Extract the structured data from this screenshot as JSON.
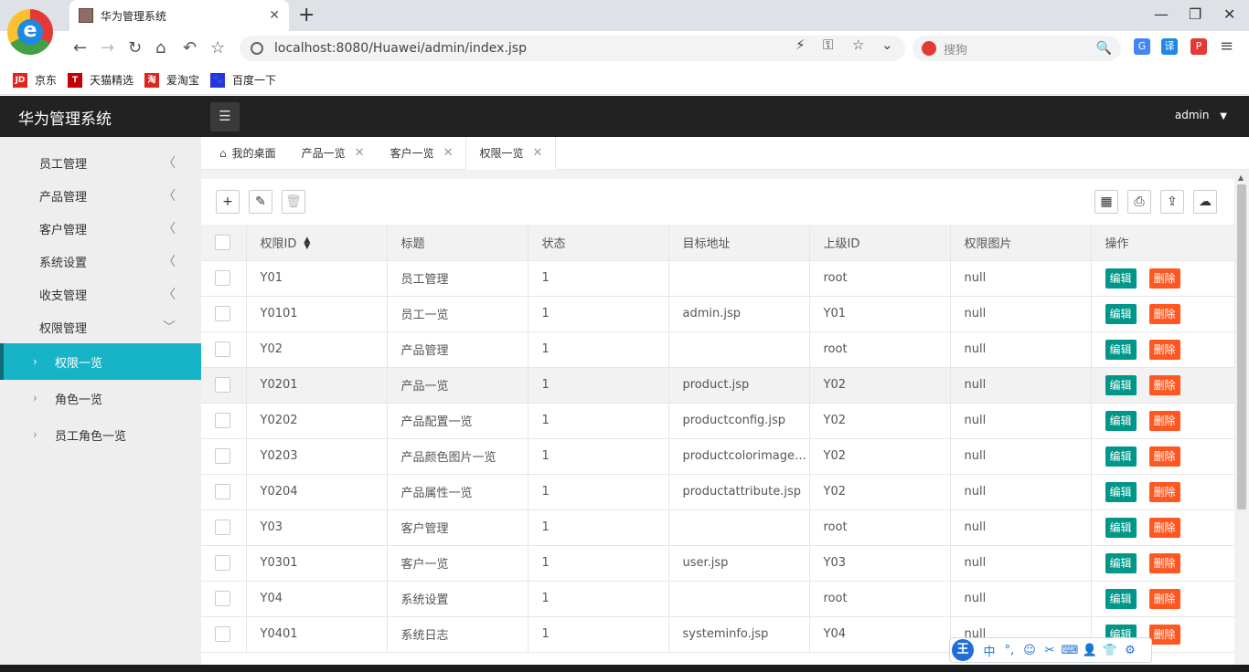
{
  "browser": {
    "tab_title": "华为管理系统",
    "tab_close": "✕",
    "new_tab": "+",
    "url": "localhost:8080/Huawei/admin/index.jsp",
    "search_placeholder": "搜狗",
    "logo_letter": "e",
    "win_min": "—",
    "win_max": "❐",
    "win_close": "✕",
    "ext_translate": "译",
    "ext_g": "G",
    "ext_pdf": "P"
  },
  "bookmarks": [
    {
      "label": "京东",
      "icon": "JD",
      "color": "#e1251b"
    },
    {
      "label": "天猫精选",
      "icon": "T",
      "color": "#c40000"
    },
    {
      "label": "爱淘宝",
      "icon": "淘",
      "color": "#e1251b"
    },
    {
      "label": "百度一下",
      "icon": "🐾",
      "color": "#2932e1"
    }
  ],
  "header": {
    "title": "华为管理系统",
    "menu_toggle": "☰",
    "user": "admin",
    "user_caret": "▼"
  },
  "sidebar": {
    "groups": [
      {
        "label": "员工管理",
        "chev": "〈"
      },
      {
        "label": "产品管理",
        "chev": "〈"
      },
      {
        "label": "客户管理",
        "chev": "〈"
      },
      {
        "label": "系统设置",
        "chev": "〈"
      },
      {
        "label": "收支管理",
        "chev": "〈"
      },
      {
        "label": "权限管理",
        "chev": "﹀"
      }
    ],
    "subitems": [
      {
        "label": "权限一览",
        "arrow": "›"
      },
      {
        "label": "角色一览",
        "arrow": "›"
      },
      {
        "label": "员工角色一览",
        "arrow": "›"
      }
    ]
  },
  "tabs": {
    "home": "我的桌面",
    "items": [
      "产品一览",
      "客户一览",
      "权限一览"
    ],
    "close": "✕"
  },
  "toolbar": {
    "add": "+",
    "edit": "✎",
    "delete": "🗑",
    "columns": "▦",
    "print": "⎙",
    "export": "⇪",
    "upload": "☁"
  },
  "table": {
    "columns": [
      "权限ID",
      "标题",
      "状态",
      "目标地址",
      "上级ID",
      "权限图片",
      "操作"
    ],
    "sort_icon": "▲▼",
    "edit_label": "编辑",
    "delete_label": "删除",
    "rows": [
      [
        "Y01",
        "员工管理",
        "1",
        "",
        "root",
        "null"
      ],
      [
        "Y0101",
        "员工一览",
        "1",
        "admin.jsp",
        "Y01",
        "null"
      ],
      [
        "Y02",
        "产品管理",
        "1",
        "",
        "root",
        "null"
      ],
      [
        "Y0201",
        "产品一览",
        "1",
        "product.jsp",
        "Y02",
        "null"
      ],
      [
        "Y0202",
        "产品配置一览",
        "1",
        "productconfig.jsp",
        "Y02",
        "null"
      ],
      [
        "Y0203",
        "产品颜色图片一览",
        "1",
        "productcolorimage.jsp",
        "Y02",
        "null"
      ],
      [
        "Y0204",
        "产品属性一览",
        "1",
        "productattribute.jsp",
        "Y02",
        "null"
      ],
      [
        "Y03",
        "客户管理",
        "1",
        "",
        "root",
        "null"
      ],
      [
        "Y0301",
        "客户一览",
        "1",
        "user.jsp",
        "Y03",
        "null"
      ],
      [
        "Y04",
        "系统设置",
        "1",
        "",
        "root",
        "null"
      ],
      [
        "Y0401",
        "系统日志",
        "1",
        "systeminfo.jsp",
        "Y04",
        "null"
      ]
    ]
  },
  "ime": {
    "logo": "王",
    "mode": "中",
    "items": [
      "°,",
      "☺",
      "✂",
      "⌨",
      "👤",
      "👕",
      "⚙"
    ]
  }
}
